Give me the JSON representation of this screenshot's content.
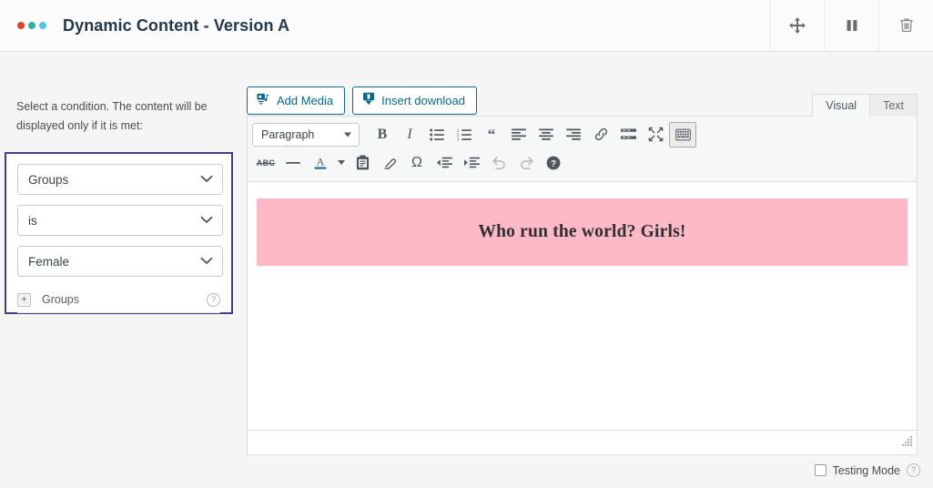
{
  "header": {
    "title": "Dynamic Content - Version A",
    "logo_dots": [
      "dot-red",
      "dot-teal",
      "dot-blue"
    ],
    "actions": [
      {
        "name": "move-icon",
        "label": "Move"
      },
      {
        "name": "pause-icon",
        "label": "Pause"
      },
      {
        "name": "trash-icon",
        "label": "Delete"
      }
    ]
  },
  "condition_panel": {
    "instruction": "Select a condition. The content will be displayed only if it is met:",
    "selects": [
      {
        "name": "condition-type-select",
        "value": "Groups"
      },
      {
        "name": "condition-operator-select",
        "value": "is"
      },
      {
        "name": "condition-value-select",
        "value": "Female"
      }
    ],
    "add_row": {
      "plus_label": "+",
      "label": "Groups",
      "help_label": "?"
    },
    "border_color": "#3a3f8f"
  },
  "editor": {
    "media_buttons": [
      {
        "name": "add-media-button",
        "label": "Add Media",
        "icon": "media-icon"
      },
      {
        "name": "insert-download-button",
        "label": "Insert download",
        "icon": "download-icon"
      }
    ],
    "tabs": [
      {
        "name": "tab-visual",
        "label": "Visual",
        "active": true
      },
      {
        "name": "tab-text",
        "label": "Text",
        "active": false
      }
    ],
    "format_select": {
      "value": "Paragraph"
    },
    "toolbar_row1": [
      {
        "name": "bold-button",
        "glyph": "B",
        "style": "b"
      },
      {
        "name": "italic-button",
        "glyph": "I",
        "style": "i"
      },
      {
        "name": "bulleted-list-button",
        "glyph": "",
        "style": "svg-ul"
      },
      {
        "name": "numbered-list-button",
        "glyph": "",
        "style": "svg-ol"
      },
      {
        "name": "blockquote-button",
        "glyph": "“",
        "style": "q"
      },
      {
        "name": "align-left-button",
        "glyph": "",
        "style": "svg-alignleft"
      },
      {
        "name": "align-center-button",
        "glyph": "",
        "style": "svg-aligncenter"
      },
      {
        "name": "align-right-button",
        "glyph": "",
        "style": "svg-alignright"
      },
      {
        "name": "insert-link-button",
        "glyph": "",
        "style": "svg-link"
      },
      {
        "name": "read-more-button",
        "glyph": "",
        "style": "svg-more"
      },
      {
        "name": "fullscreen-button",
        "glyph": "",
        "style": "svg-fullscreen"
      },
      {
        "name": "toolbar-toggle-button",
        "glyph": "",
        "style": "svg-kitchensink",
        "pressed": true
      }
    ],
    "toolbar_row2": [
      {
        "name": "strikethrough-button",
        "glyph": "ABC",
        "style": "abc"
      },
      {
        "name": "horizontal-rule-button",
        "glyph": "",
        "style": "svg-hr"
      },
      {
        "name": "text-color-button",
        "glyph": "A",
        "style": "svg-textcolor"
      },
      {
        "name": "text-color-dropdown",
        "glyph": "",
        "style": "caret"
      },
      {
        "name": "paste-as-text-button",
        "glyph": "",
        "style": "svg-paste"
      },
      {
        "name": "clear-formatting-button",
        "glyph": "",
        "style": "svg-eraser"
      },
      {
        "name": "special-character-button",
        "glyph": "Ω",
        "style": "omega"
      },
      {
        "name": "decrease-indent-button",
        "glyph": "",
        "style": "svg-outdent"
      },
      {
        "name": "increase-indent-button",
        "glyph": "",
        "style": "svg-indent"
      },
      {
        "name": "undo-button",
        "glyph": "",
        "style": "svg-undo"
      },
      {
        "name": "redo-button",
        "glyph": "",
        "style": "svg-redo"
      },
      {
        "name": "editor-help-button",
        "glyph": "?",
        "style": "svg-help"
      }
    ],
    "content": {
      "block_text": "Who run the world? Girls!",
      "block_background": "#fdb9c6"
    },
    "resize_handle": "resize-grip"
  },
  "footer": {
    "testing_mode_label": "Testing Mode",
    "testing_mode_checked": false,
    "help_label": "?"
  }
}
